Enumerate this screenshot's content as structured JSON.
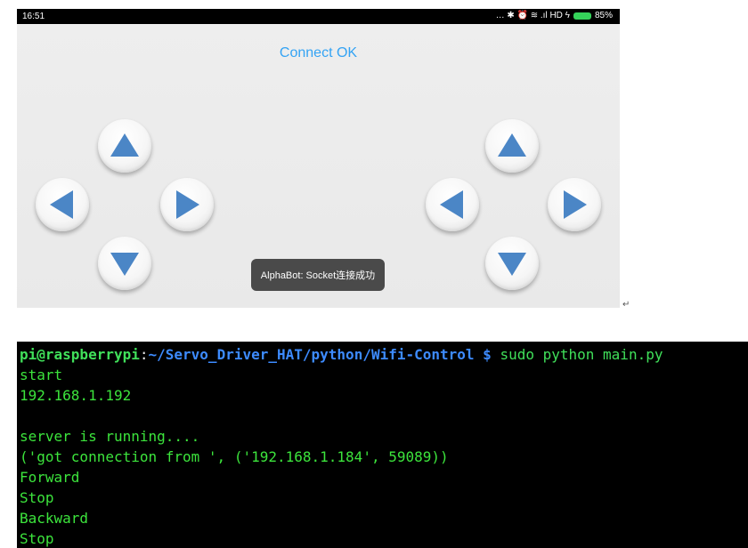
{
  "phone": {
    "status_bar": {
      "time": "16:51",
      "icons_text": "… ✱ ⏰ ≋ .ıl HD ϟ",
      "battery": "85%"
    },
    "connect_status": "Connect OK",
    "toast": "AlphaBot: Socket连接成功",
    "colors": {
      "accent": "#33a3f4",
      "arrow": "#4b86c6"
    },
    "left_pad": [
      "up-arrow-icon",
      "left-arrow-icon",
      "right-arrow-icon",
      "down-arrow-icon"
    ],
    "right_pad": [
      "up-arrow-icon",
      "left-arrow-icon",
      "right-arrow-icon",
      "down-arrow-icon"
    ]
  },
  "return_mark": "↵",
  "terminal": {
    "prompt": {
      "user_host": "pi@raspberrypi",
      "colon": ":",
      "path": "~/Servo_Driver_HAT/python/Wifi-Control",
      "dollar": " $",
      "command": " sudo python main.py"
    },
    "lines": [
      "start",
      "192.168.1.192",
      "",
      "server is running....",
      "('got connection from ', ('192.168.1.184', 59089))",
      "Forward",
      "Stop",
      "Backward",
      "Stop"
    ]
  }
}
